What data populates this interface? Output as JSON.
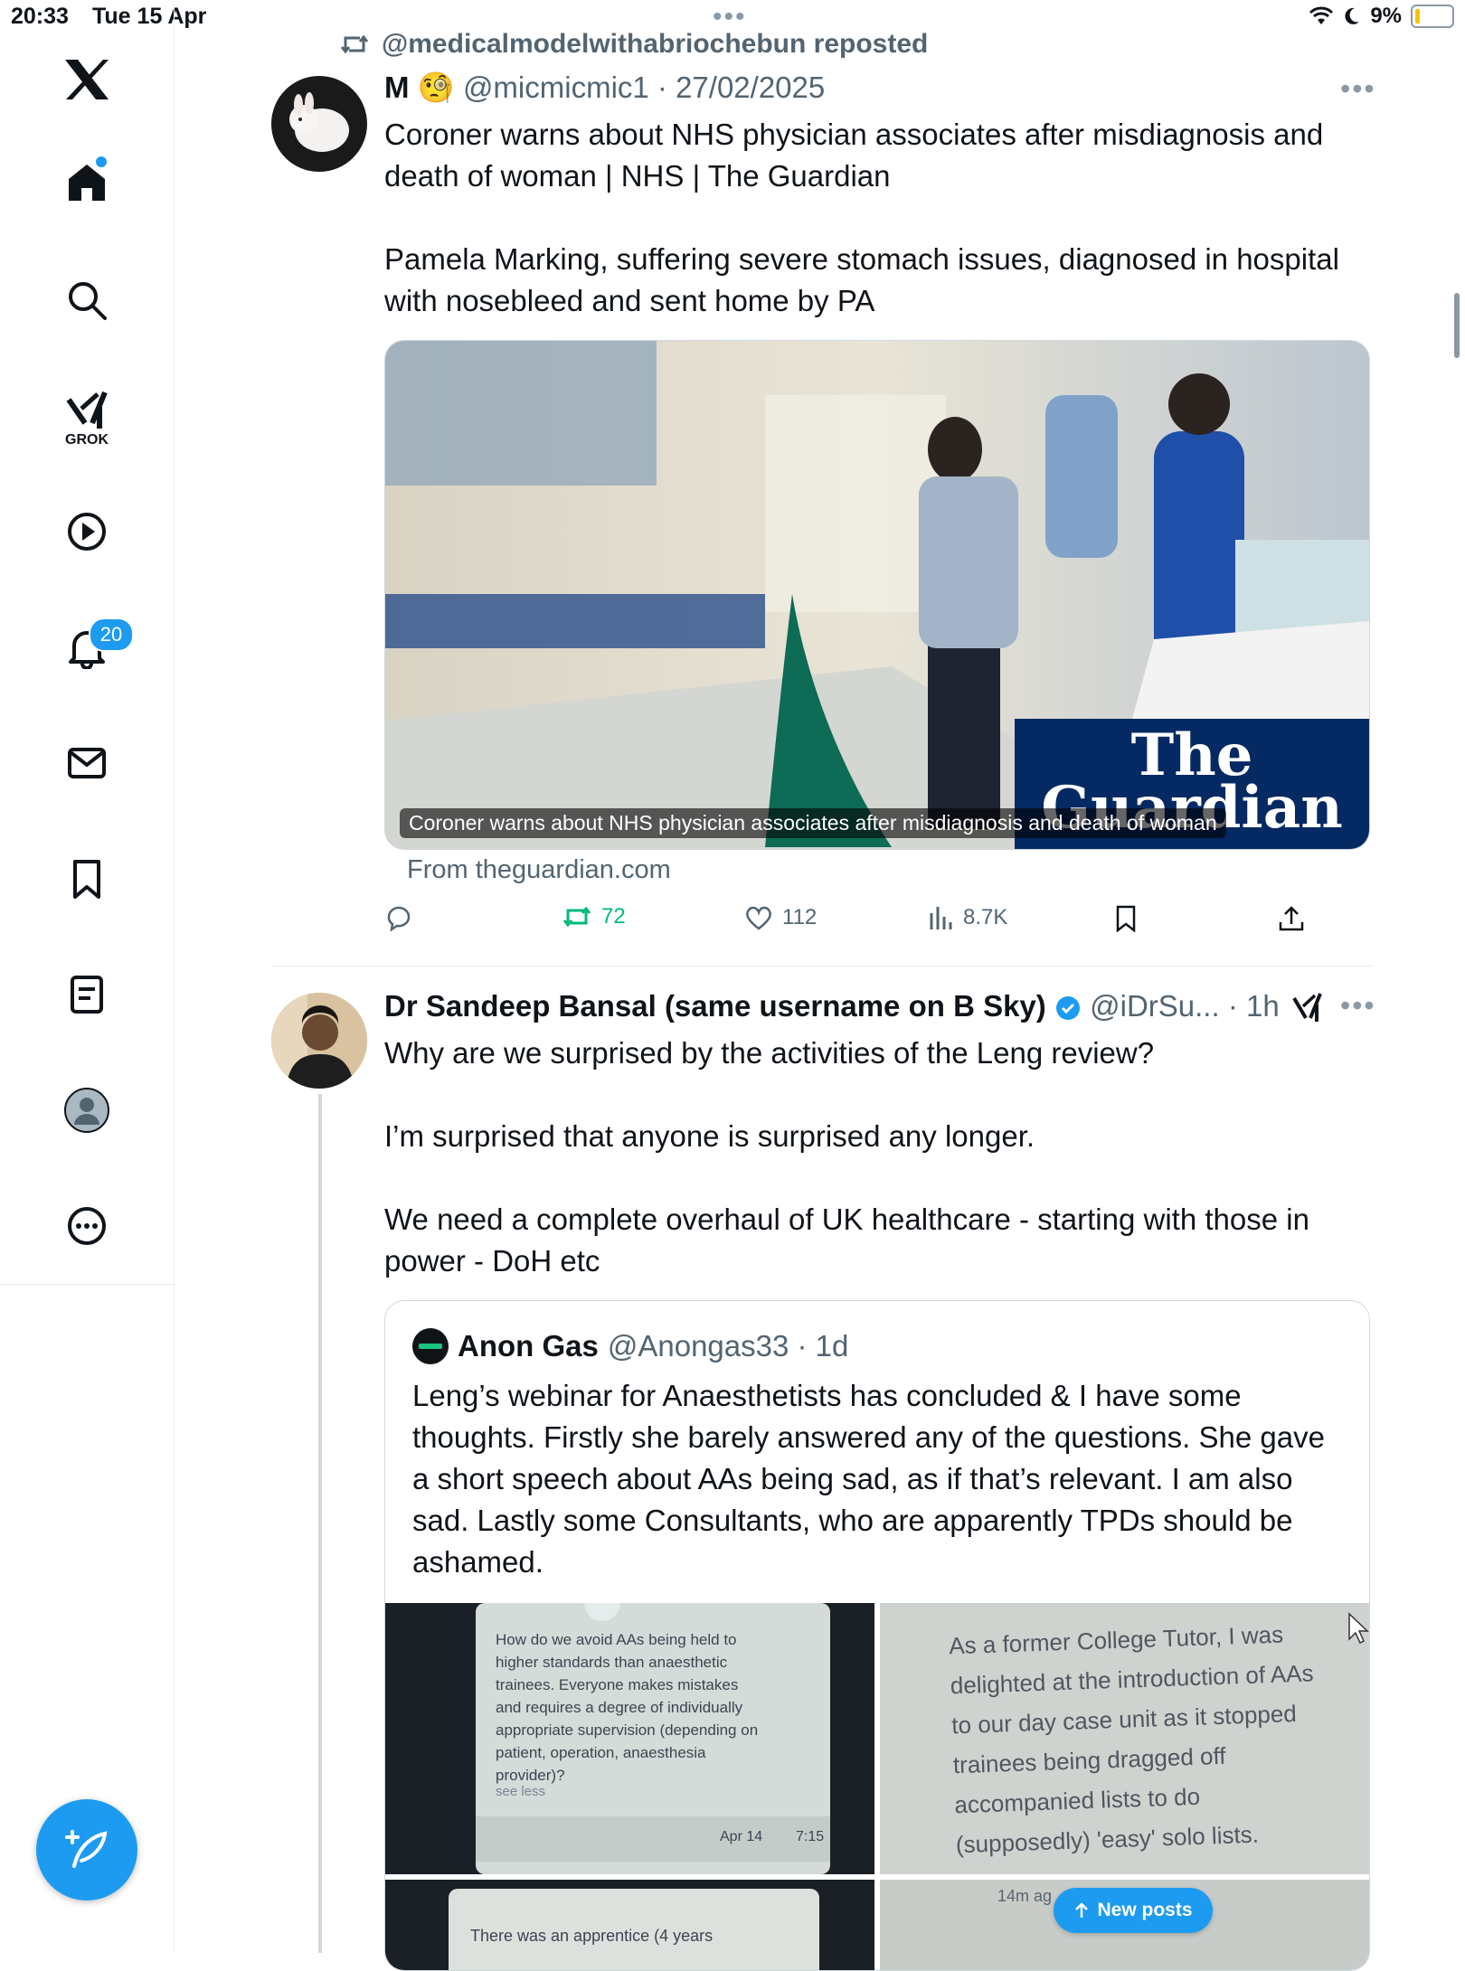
{
  "status_bar": {
    "time": "20:33",
    "date": "Tue 15 Apr",
    "battery": "9%"
  },
  "sidebar": {
    "grok_label": "GROK",
    "notifications_count": "20"
  },
  "tweet1": {
    "reposted_by": "@medicalmodelwithabriochebun reposted",
    "author_name": "M",
    "author_emoji": "🧐",
    "author_meta": "@micmicmic1 · 27/02/2025",
    "text": "Coroner warns about NHS physician associates after misdiagnosis and\ndeath of woman | NHS | The Guardian\n\nPamela Marking, suffering severe stomach issues, diagnosed in hospital\nwith nosebleed and sent home by PA",
    "card": {
      "logo": "The Guardian",
      "caption": "Coroner warns about NHS physician associates after misdiagnosis and death of woman",
      "source": "From theguardian.com"
    },
    "actions": {
      "retweets": "72",
      "likes": "112",
      "views": "8.7K"
    }
  },
  "tweet2": {
    "author_name": "Dr Sandeep Bansal (same username on B Sky)",
    "author_meta": "@iDrSu... · 1h",
    "text": "Why are we surprised by the activities of the Leng review?\n\nI’m surprised that anyone is surprised any longer.\n\nWe need a complete overhaul of UK healthcare - starting with those in\npower - DoH etc",
    "quote": {
      "author_name": "Anon Gas",
      "author_meta": "@Anongas33 · 1d",
      "text": "Leng’s webinar for Anaesthetists has concluded & I have some thoughts. Firstly she barely answered any of the questions. She gave a short speech about AAs being sad, as if that’s relevant. I am also sad. Lastly some Consultants, who are apparently TPDs should be ashamed.",
      "img1": {
        "text": "How do we avoid AAs being held to higher standards than anaesthetic trainees. Everyone makes mistakes and requires a degree of individually appropriate supervision (depending on patient, operation, anaesthesia provider)?",
        "see_less": "see less",
        "date": "Apr 14",
        "time": "7:15"
      },
      "img2": {
        "text": "As a former College Tutor, I was delighted at the introduction of AAs to our day case unit as it stopped trainees being dragged off accompanied lists to do (supposedly) 'easy' solo lists."
      },
      "img3": {
        "text": "There was an apprentice (4 years"
      },
      "img4": {
        "text": "14m ag"
      }
    }
  },
  "new_posts": "New posts",
  "colors": {
    "accent": "#1d9bf0",
    "retweet_green": "#00ba7c",
    "guardian_blue": "#052962"
  }
}
